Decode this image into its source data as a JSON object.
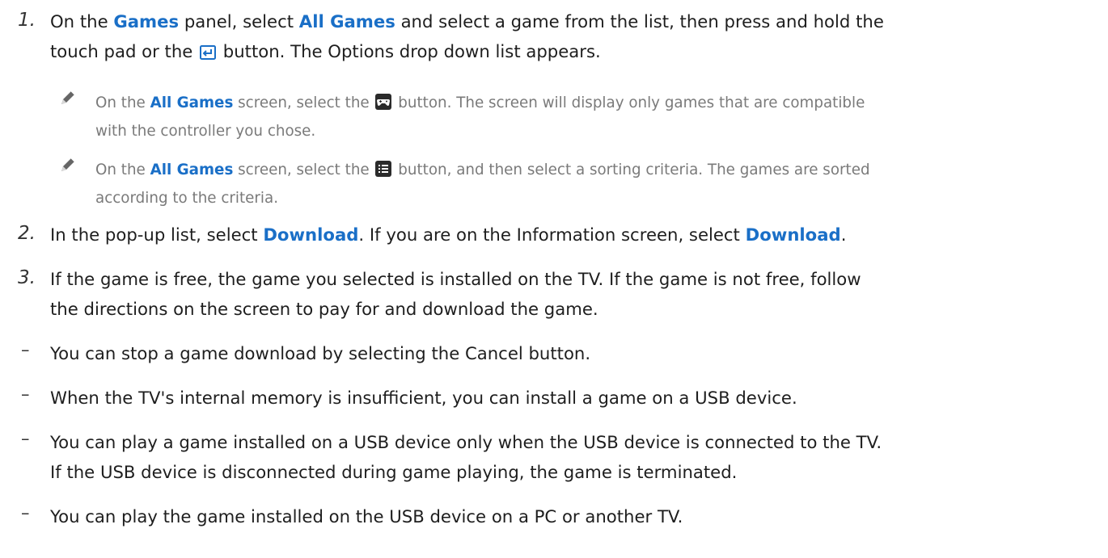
{
  "step1": {
    "number": "1.",
    "t1": "On the ",
    "k1": "Games",
    "t2": " panel, select ",
    "k2": "All Games",
    "t3": " and select a game from the list, then press and hold the",
    "t4": "touch pad or the ",
    "t5": " button. The Options drop down list appears."
  },
  "note1": {
    "t1": "On the ",
    "k1": "All Games",
    "t2": " screen, select the ",
    "t3": " button. The screen will display only games that are compatible",
    "t4": "with the controller you chose."
  },
  "note2": {
    "t1": "On the ",
    "k1": "All Games",
    "t2": " screen, select the ",
    "t3": " button, and then select a sorting criteria. The games are sorted",
    "t4": "according to the criteria."
  },
  "step2": {
    "number": "2.",
    "t1": "In the pop-up list, select ",
    "k1": "Download",
    "t2": ". If you are on the Information screen, select ",
    "k2": "Download",
    "t3": "."
  },
  "step3": {
    "number": "3.",
    "line1": "If the game is free, the game you selected is installed on the TV. If the game is not free, follow",
    "line2": "the directions on the screen to pay for and download the game."
  },
  "bullets": {
    "dash": "–",
    "b1": "You can stop a game download by selecting the Cancel button.",
    "b2": "When the TV's internal memory is insufficient, you can install a game on a USB device.",
    "b3_line1": "You can play a game installed on a USB device only when the USB device is connected to the TV.",
    "b3_line2": "If the USB device is disconnected during game playing, the game is terminated.",
    "b4": "You can play the game installed on the USB device on a PC or another TV."
  },
  "icons": {
    "enter": "enter-button-icon",
    "gamepad": "gamepad-button-icon",
    "list": "list-button-icon",
    "note": "pencil-note-icon"
  },
  "colors": {
    "keyword": "#1a6fc7",
    "text": "#1e1e1e",
    "note_text": "#7a7a7a"
  }
}
